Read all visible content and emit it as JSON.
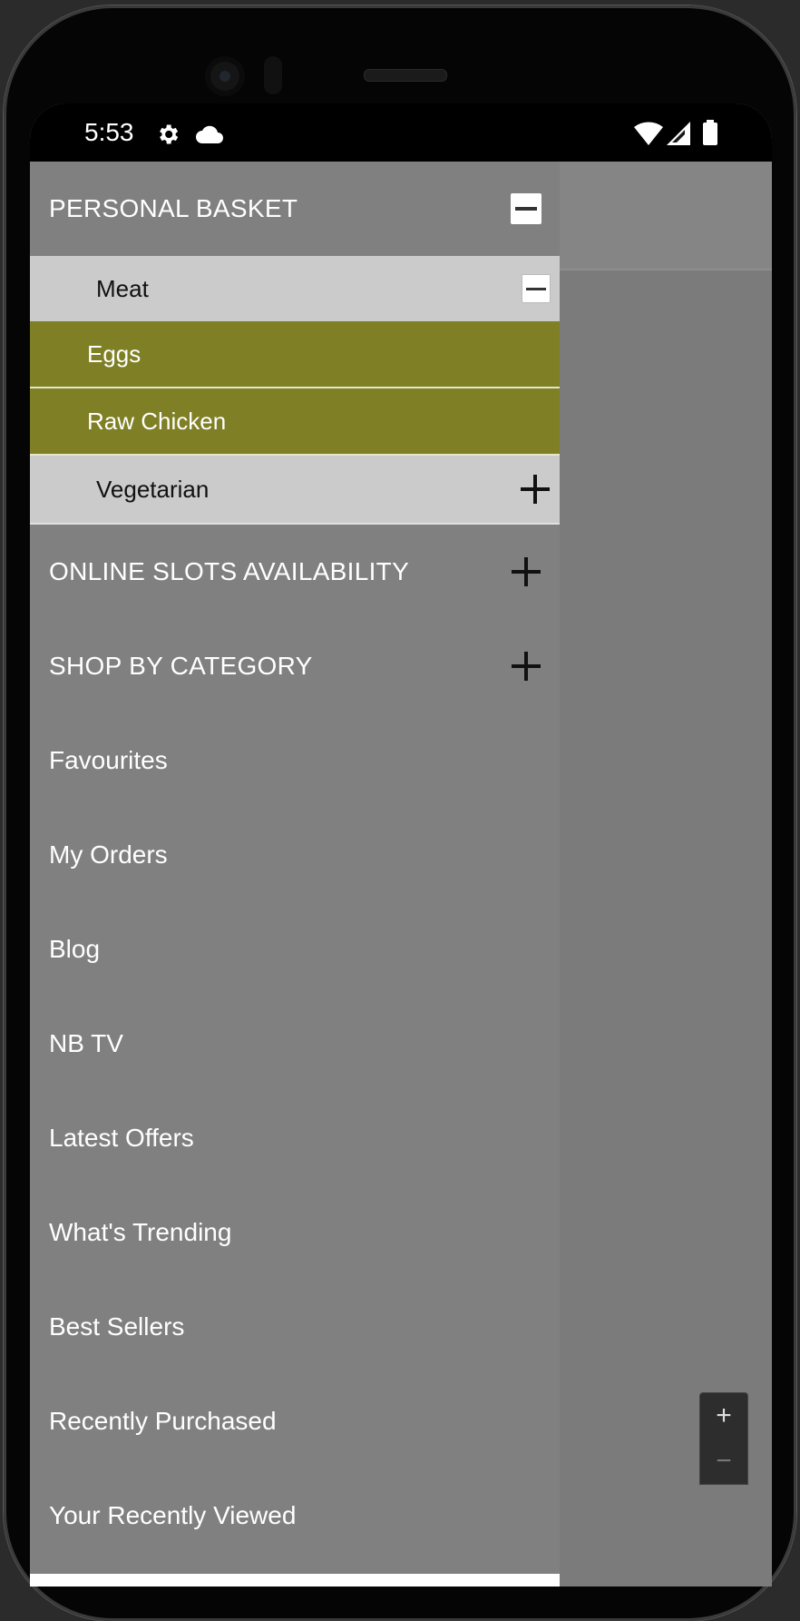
{
  "status_bar": {
    "time": "5:53",
    "icons": [
      "settings-icon",
      "cloud-icon",
      "wifi-icon",
      "signal-icon",
      "battery-icon"
    ]
  },
  "drawer": {
    "personal_basket": {
      "label": "PERSONAL BASKET",
      "expanded": true,
      "groups": [
        {
          "label": "Meat",
          "expanded": true,
          "items": [
            "Eggs",
            "Raw Chicken"
          ]
        },
        {
          "label": "Vegetarian",
          "expanded": false,
          "items": []
        }
      ]
    },
    "online_slots": {
      "label": "ONLINE SLOTS AVAILABILITY",
      "expanded": false
    },
    "shop_by_category": {
      "label": "SHOP BY CATEGORY",
      "expanded": false
    },
    "links": [
      "Favourites",
      "My Orders",
      "Blog",
      "NB TV",
      "Latest Offers",
      "What's Trending",
      "Best Sellers",
      "Recently Purchased",
      "Your Recently Viewed"
    ]
  },
  "zoom_control": {
    "plus": "+",
    "minus": "−"
  },
  "colors": {
    "drawer_bg": "#808080",
    "subgroup_bg": "#cbcbcb",
    "item_bg": "#7f7f25"
  }
}
